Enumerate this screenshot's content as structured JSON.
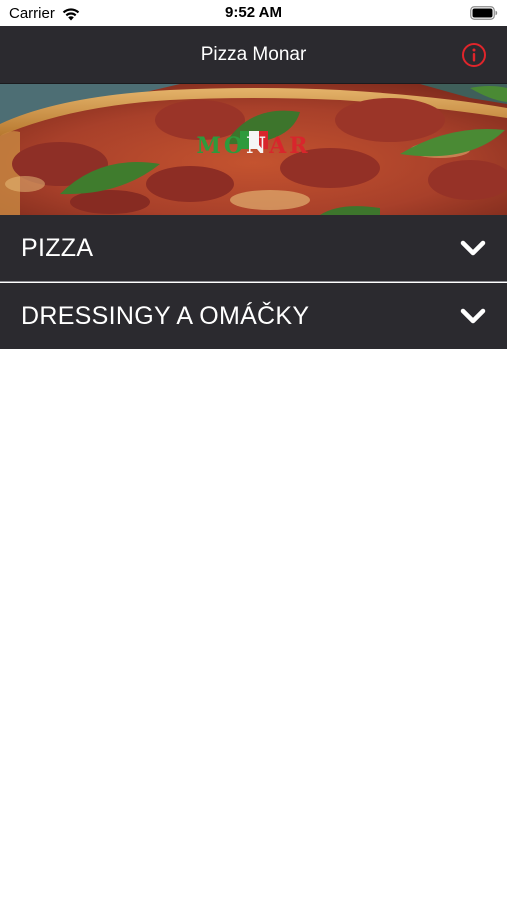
{
  "status_bar": {
    "carrier": "Carrier",
    "time": "9:52 AM"
  },
  "nav_bar": {
    "title": "Pizza Monar",
    "info_icon": "info-circle-icon",
    "info_color": "#e0252b"
  },
  "banner": {
    "logo_parts": [
      "MO",
      "N",
      "AR"
    ],
    "flag_colors": [
      "#2e9a3c",
      "#f5f5f5",
      "#d8262c"
    ]
  },
  "categories": [
    {
      "label": "PIZZA",
      "icon": "chevron-down-icon"
    },
    {
      "label": "DRESSINGY A OMÁČKY",
      "icon": "chevron-down-icon"
    }
  ],
  "colors": {
    "bar_background": "#2b2a2f",
    "text_light": "#ffffff"
  }
}
